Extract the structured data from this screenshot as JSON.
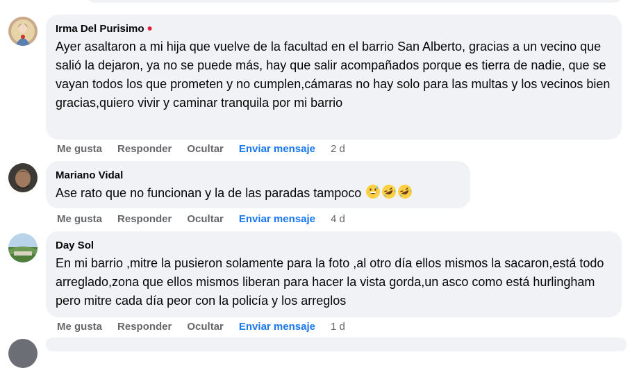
{
  "comments": [
    {
      "author": "Irma Del Purisimo",
      "online": true,
      "text": "Ayer asaltaron a mi hija que vuelve de la facultad en el barrio San Alberto, gracias a un vecino que salió la dejaron, ya no se puede más, hay que salir acompañados porque es tierra de nadie, que se vayan todos los que prometen y no cumplen,cámaras no hay solo para las multas y los vecinos bien gracias,quiero vivir y caminar tranquila por mi barrio",
      "time": "2 d"
    },
    {
      "author": "Mariano Vidal",
      "text": "Ase rato que no funcionan y la de las paradas tampoco",
      "emojis": [
        "grinning-sweat",
        "rofl",
        "rofl"
      ],
      "time": "4 d"
    },
    {
      "author": "Day Sol",
      "text": "En mi barrio ,mitre la pusieron solamente para la foto ,al otro día ellos mismos la sacaron,está todo arreglado,zona que ellos mismos liberan para hacer la vista gorda,un asco como está hurlingham pero mitre cada día peor con la policía y los arreglos",
      "time": "1 d"
    }
  ],
  "actions": {
    "like": "Me gusta",
    "reply": "Responder",
    "hide": "Ocultar",
    "send_message": "Enviar mensaje"
  },
  "colors": {
    "bubble": "#f0f2f5",
    "meta": "#65676b",
    "link": "#1877f2",
    "online_dot": "#e41e3f"
  }
}
